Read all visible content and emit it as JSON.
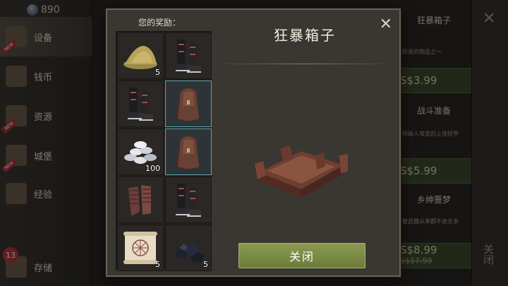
{
  "currency": {
    "amount": "890"
  },
  "sidebar": {
    "items": [
      {
        "label": "设备",
        "new": "NEW"
      },
      {
        "label": "钱币"
      },
      {
        "label": "资源",
        "new": "NEW"
      },
      {
        "label": "城堡",
        "new": "NEW"
      },
      {
        "label": "经验"
      },
      {
        "label": "存储",
        "badge": "13"
      }
    ]
  },
  "background_store": {
    "cards": [
      {
        "title": "狂暴箱子",
        "desc": "最珍贵的物品之一",
        "price": "S$3.99"
      },
      {
        "title": "战斗准备",
        "desc": "任何敌人攻击的上佳轻甲",
        "price": "S$5.99"
      },
      {
        "title": "乡绅噩梦",
        "desc": "这套武器从来都不会太多",
        "price": "S$8.99",
        "old_price": "S$17.99"
      }
    ],
    "close_label": "关闭"
  },
  "dialog": {
    "reward_label": "您的奖励：",
    "title": "狂暴箱子",
    "close_button": "关闭",
    "rewards": [
      {
        "item": "gold-sand",
        "qty": "5"
      },
      {
        "item": "boots",
        "qty": ""
      },
      {
        "item": "boots",
        "qty": ""
      },
      {
        "item": "backpack",
        "qty": ""
      },
      {
        "item": "silver-coins",
        "qty": "100"
      },
      {
        "item": "backpack",
        "qty": ""
      },
      {
        "item": "gloves",
        "qty": ""
      },
      {
        "item": "boots",
        "qty": ""
      },
      {
        "item": "map-scroll",
        "qty": "5"
      },
      {
        "item": "coal",
        "qty": "5"
      }
    ]
  },
  "colors": {
    "accent_button": "#7d8c44",
    "highlight": "#5aa5b0"
  }
}
